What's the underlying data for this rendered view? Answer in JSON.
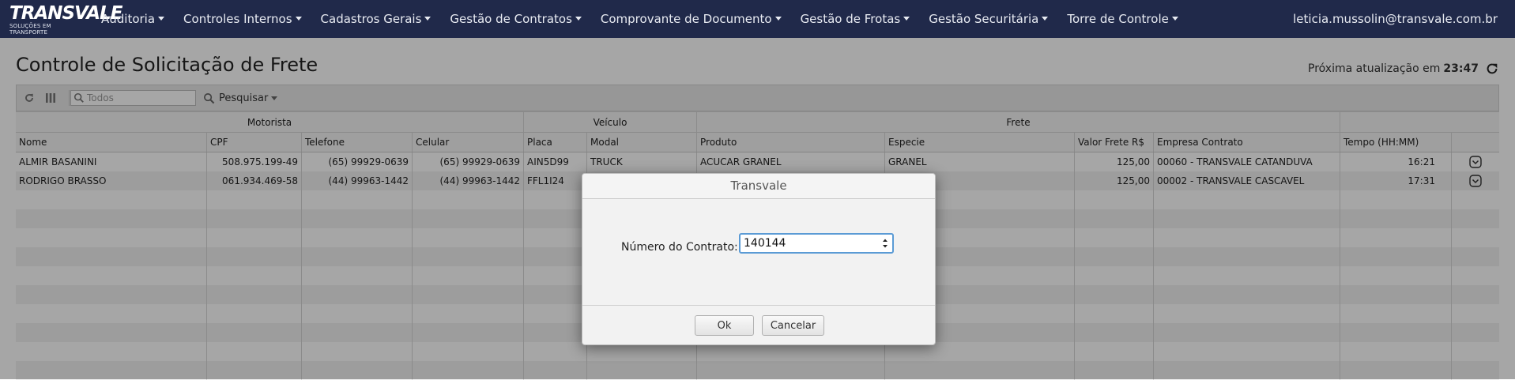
{
  "navbar": {
    "logo_main": "TRANSVALE",
    "logo_sub": "SOLUÇÕES EM TRANSPORTE",
    "menu": [
      {
        "label": "Auditoria"
      },
      {
        "label": "Controles Internos"
      },
      {
        "label": "Cadastros Gerais"
      },
      {
        "label": "Gestão de Contratos"
      },
      {
        "label": "Comprovante de Documento"
      },
      {
        "label": "Gestão de Frotas"
      },
      {
        "label": "Gestão Securitária"
      },
      {
        "label": "Torre de Controle"
      }
    ],
    "user": "leticia.mussolin@transvale.com.br"
  },
  "page": {
    "title": "Controle de Solicitação de Frete",
    "refresh_label": "Próxima atualização em",
    "refresh_time": "23:47"
  },
  "toolbar": {
    "search_placeholder": "Todos",
    "search_button": "Pesquisar"
  },
  "grid": {
    "groups": [
      "Motorista",
      "Veículo",
      "Frete"
    ],
    "columns": [
      "Nome",
      "CPF",
      "Telefone",
      "Celular",
      "Placa",
      "Modal",
      "Produto",
      "Especie",
      "Valor Frete R$",
      "Empresa Contrato",
      "Tempo (HH:MM)"
    ],
    "rows": [
      [
        "ALMIR BASANINI",
        "508.975.199-49",
        "(65) 99929-0639",
        "(65) 99929-0639",
        "AIN5D99",
        "TRUCK",
        "ACUCAR GRANEL",
        "GRANEL",
        "125,00",
        "00060 - TRANSVALE CATANDUVA",
        "16:21"
      ],
      [
        "RODRIGO BRASSO",
        "061.934.469-58",
        "(44) 99963-1442",
        "(44) 99963-1442",
        "FFL1I24",
        "",
        "",
        "",
        "125,00",
        "00002 - TRANSVALE CASCAVEL",
        "17:31"
      ]
    ]
  },
  "dialog": {
    "title": "Transvale",
    "field_label": "Número do Contrato:",
    "field_value": "140144",
    "ok_label": "Ok",
    "cancel_label": "Cancelar"
  },
  "colors": {
    "navbar_bg": "#20294a",
    "input_focus": "#5b9bd5"
  },
  "icons": [
    "refresh-icon",
    "columns-icon",
    "search-icon",
    "caret-down-icon",
    "chevron-circle-icon",
    "spinner-arrows-icon"
  ]
}
